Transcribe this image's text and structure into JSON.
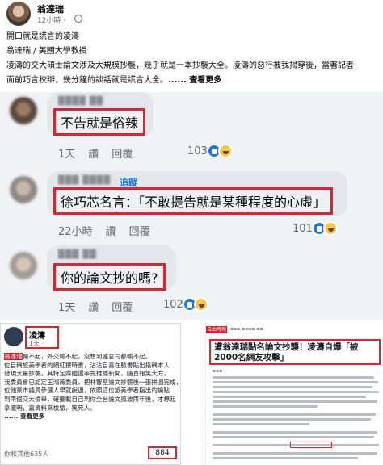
{
  "post": {
    "author": "翁達瑞",
    "time": "12小時 · ",
    "body": [
      "開口就是謊言的凌濤",
      "翁達瑞 / 美國大學教授",
      "凌濤的交大碩士論文涉及大規模抄襲，幾乎就是一本抄襲大全。凌濤的惡行被我揭穿後，當著記者",
      "面前巧言狡辯，幾分鐘的談話就是謊言大全。"
    ],
    "more": "...... 查看更多"
  },
  "comments": [
    {
      "text": "不告就是俗辣",
      "time": "1天",
      "like": "讚",
      "reply": "回覆",
      "count": "103"
    },
    {
      "follow": "追蹤",
      "text": "徐巧芯名言：「不敢提告就是某種程度的心虛」",
      "time": "22小時",
      "like": "讚",
      "reply": "回覆",
      "count": "101"
    },
    {
      "text": "你的論文抄的嗎?",
      "time": "1天",
      "like": "讚",
      "reply": "回覆",
      "count": "102"
    }
  ],
  "screenshot_left": {
    "name": "凌濤",
    "time": "1天 · ",
    "lines": [
      "翁達瑞",
      "輸不起，外交輸不起，沒想到連官司都輸不起。",
      "位自稱旅美學者的網紅撰時書，沾沾自喜在臉書貼出指稱本人",
      "發現大量抄襲，其特定媒體還率先推播新聞，隨直報笑大方，",
      "我委員會已認定王鴻薇委員，把林智堅論文抄襲後一張拼圖完成，",
      "位他黨市議員參選人早就說過，依照這位旅美學者指出的論點",
      "到兩個交大檢舉，確擺載自己到你全台論文風波兩年後，才想起",
      "拿擺明，嘉資料來檢驗，笑死人。"
    ],
    "more": "...... 查看更多",
    "likes": "你和其他635人",
    "badge": "884"
  },
  "screenshot_right": {
    "logo": "自由時報",
    "title": "遭翁達瑞點名論文抄襲！凌濤自爆「被2000名網友攻擊」"
  },
  "colors": {
    "highlight": "#e0242b",
    "fb_blue": "#1877f2",
    "comment_bg": "#f0f2f5"
  },
  "icons": [
    "globe-icon",
    "like-reaction-icon",
    "haha-reaction-icon"
  ]
}
